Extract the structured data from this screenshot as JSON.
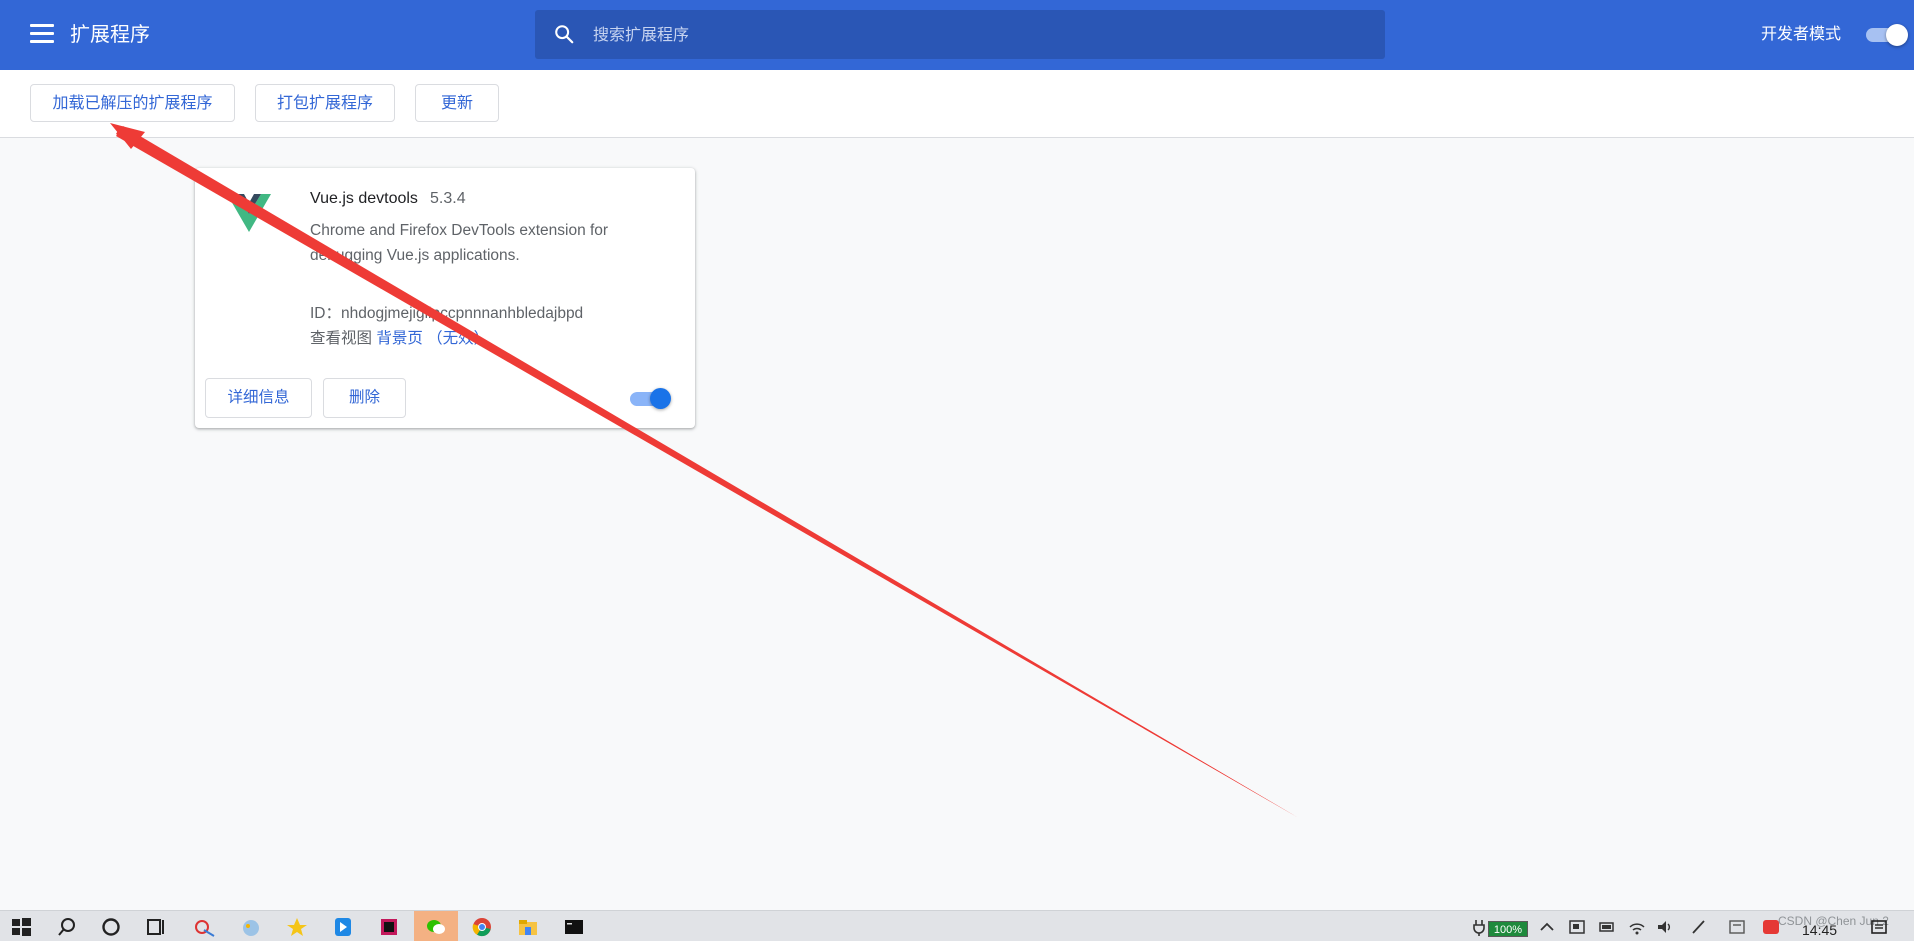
{
  "header": {
    "title": "扩展程序",
    "search_placeholder": "搜索扩展程序",
    "developer_mode_label": "开发者模式",
    "developer_mode_on": true
  },
  "toolbar": {
    "load_unpacked_label": "加载已解压的扩展程序",
    "pack_label": "打包扩展程序",
    "update_label": "更新"
  },
  "extension": {
    "name": "Vue.js devtools",
    "version": "5.3.4",
    "description": "Chrome and Firefox DevTools extension for debugging Vue.js applications.",
    "id_label": "ID：",
    "id": "nhdogjmejiglipccpnnnanhbledajbpd",
    "views_label": "查看视图",
    "background_page_label": "背景页",
    "inactive_label": "（无效）",
    "details_label": "详细信息",
    "remove_label": "删除",
    "enabled": true
  },
  "taskbar": {
    "battery": "100%",
    "time": "14:45",
    "watermark": "CSDN @Chen Jun 2"
  },
  "colors": {
    "header_bg": "#3367d6",
    "accent": "#3367d6",
    "annotation_arrow": "#ee3b36"
  },
  "icons": [
    "menu-icon",
    "search-icon",
    "vue-logo-icon",
    "windows-start-icon",
    "taskbar-search-icon",
    "cortana-icon",
    "task-view-icon",
    "chrome-icon",
    "wechat-icon",
    "file-explorer-icon",
    "terminal-icon"
  ]
}
